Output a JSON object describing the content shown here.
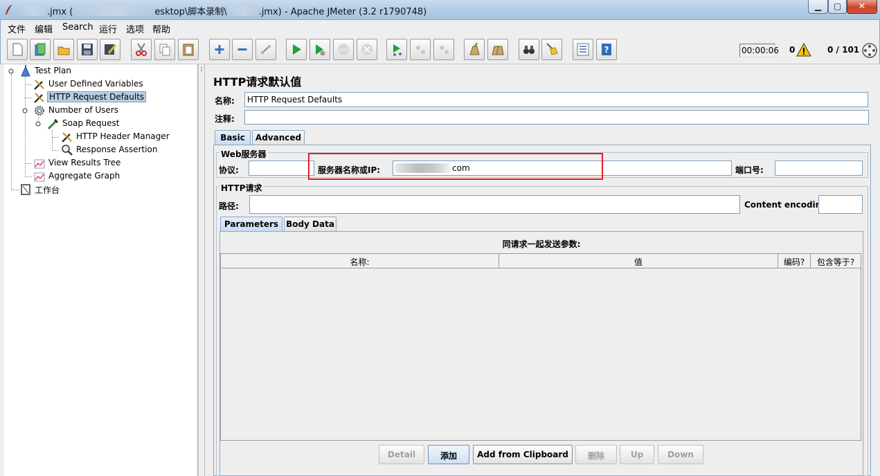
{
  "window": {
    "title_part1": ".jmx (",
    "title_part2": "esktop\\脚本录制\\",
    "title_part3": ".jmx) - Apache JMeter (3.2 r1790748)",
    "minimize_glyph": "▁",
    "maximize_glyph": "▢",
    "close_glyph": "✕"
  },
  "menu": [
    "文件",
    "编辑",
    "Search",
    "运行",
    "选项",
    "帮助"
  ],
  "toolbar": {
    "icons": [
      "new-icon",
      "templates-icon",
      "open-icon",
      "save-icon",
      "save-as-icon",
      "cut-icon",
      "copy-icon",
      "paste-icon",
      "expand-icon",
      "collapse-icon",
      "toggle-icon",
      "start-icon",
      "start-no-pause-icon",
      "stop-icon",
      "shutdown-icon",
      "remote-start-icon",
      "remote-stop-icon",
      "remote-shutdown-icon",
      "clear-icon",
      "clear-all-icon",
      "search-icon",
      "reset-search-icon",
      "function-helper-icon",
      "help-icon"
    ],
    "timer": "00:00:06",
    "error_count": "0",
    "threads": "0 / 101"
  },
  "tree": {
    "items": [
      {
        "label": "Test Plan",
        "icon": "test-plan-icon"
      },
      {
        "label": "User Defined Variables",
        "icon": "wrench-icon"
      },
      {
        "label": "HTTP Request Defaults",
        "icon": "wrench-icon"
      },
      {
        "label": "Number of Users",
        "icon": "gear-icon"
      },
      {
        "label": "Soap Request",
        "icon": "pipette-icon"
      },
      {
        "label": "HTTP Header Manager",
        "icon": "wrench-icon"
      },
      {
        "label": "Response Assertion",
        "icon": "magnifier-icon"
      },
      {
        "label": "View Results Tree",
        "icon": "chart-icon"
      },
      {
        "label": "Aggregate Graph",
        "icon": "chart-icon"
      },
      {
        "label": "工作台",
        "icon": "workbench-icon"
      }
    ]
  },
  "panel": {
    "title": "HTTP请求默认值",
    "name_label": "名称:",
    "name_value": "HTTP Request Defaults",
    "comment_label": "注释:",
    "comment_value": "",
    "tabs": [
      "Basic",
      "Advanced"
    ],
    "web_server": {
      "title": "Web服务器",
      "protocol_label": "协议:",
      "protocol_value": "",
      "server_label": "服务器名称或IP:",
      "server_value_suffix": "com",
      "port_label": "端口号:",
      "port_value": ""
    },
    "http_request": {
      "title": "HTTP请求",
      "path_label": "路径:",
      "path_value": "",
      "encoding_label": "Content encoding:",
      "encoding_value": ""
    },
    "subtabs": [
      "Parameters",
      "Body Data"
    ],
    "params": {
      "caption": "同请求一起发送参数:",
      "columns": [
        "名称:",
        "值",
        "编码?",
        "包含等于?"
      ]
    },
    "buttons": [
      "Detail",
      "添加",
      "Add from Clipboard",
      "删除",
      "Up",
      "Down"
    ]
  }
}
